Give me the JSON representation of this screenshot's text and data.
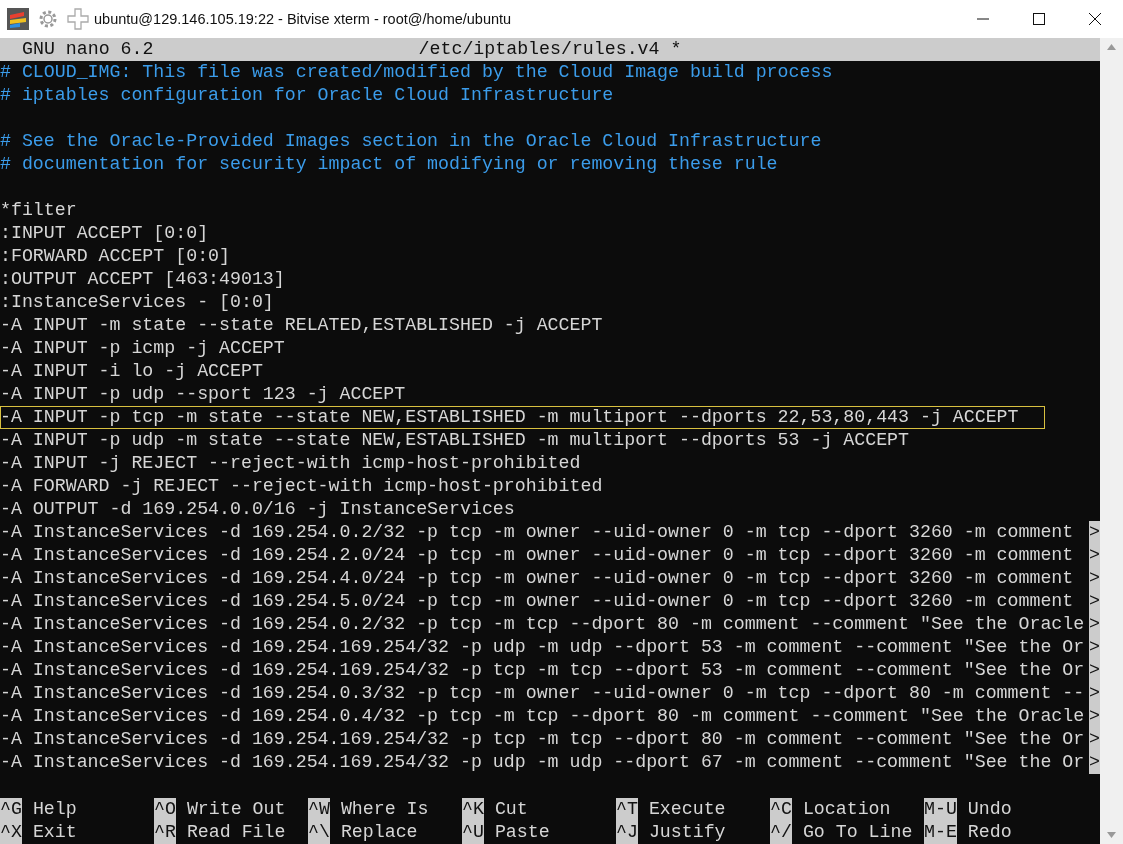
{
  "window": {
    "title": "ubuntu@129.146.105.19:22 - Bitvise xterm - root@/home/ubuntu"
  },
  "nano_header": {
    "app": "GNU nano 6.2",
    "file": "/etc/iptables/rules.v4 *"
  },
  "lines": [
    {
      "kind": "comment",
      "text": "# CLOUD_IMG: This file was created/modified by the Cloud Image build process"
    },
    {
      "kind": "comment",
      "text": "# iptables configuration for Oracle Cloud Infrastructure"
    },
    {
      "kind": "blank"
    },
    {
      "kind": "comment",
      "text": "# See the Oracle-Provided Images section in the Oracle Cloud Infrastructure"
    },
    {
      "kind": "comment",
      "text": "# documentation for security impact of modifying or removing these rule"
    },
    {
      "kind": "blank"
    },
    {
      "kind": "code",
      "text": "*filter"
    },
    {
      "kind": "code",
      "text": ":INPUT ACCEPT [0:0]"
    },
    {
      "kind": "code",
      "text": ":FORWARD ACCEPT [0:0]"
    },
    {
      "kind": "code",
      "text": ":OUTPUT ACCEPT [463:49013]"
    },
    {
      "kind": "code",
      "text": ":InstanceServices - [0:0]"
    },
    {
      "kind": "code",
      "text": "-A INPUT -m state --state RELATED,ESTABLISHED -j ACCEPT"
    },
    {
      "kind": "code",
      "text": "-A INPUT -p icmp -j ACCEPT"
    },
    {
      "kind": "code",
      "text": "-A INPUT -i lo -j ACCEPT"
    },
    {
      "kind": "code",
      "text": "-A INPUT -p udp --sport 123 -j ACCEPT"
    },
    {
      "kind": "code",
      "text": "-A INPUT -p tcp -m state --state NEW,ESTABLISHED -m multiport --dports 22,53,80,443 -j ACCEPT",
      "highlighted": true
    },
    {
      "kind": "code",
      "text": "-A INPUT -p udp -m state --state NEW,ESTABLISHED -m multiport --dports 53 -j ACCEPT"
    },
    {
      "kind": "code",
      "text": "-A INPUT -j REJECT --reject-with icmp-host-prohibited"
    },
    {
      "kind": "code",
      "text": "-A FORWARD -j REJECT --reject-with icmp-host-prohibited"
    },
    {
      "kind": "code",
      "text": "-A OUTPUT -d 169.254.0.0/16 -j InstanceServices"
    },
    {
      "kind": "code",
      "text": "-A InstanceServices -d 169.254.0.2/32 -p tcp -m owner --uid-owner 0 -m tcp --dport 3260 -m comment",
      "more": ">"
    },
    {
      "kind": "code",
      "text": "-A InstanceServices -d 169.254.2.0/24 -p tcp -m owner --uid-owner 0 -m tcp --dport 3260 -m comment",
      "more": ">"
    },
    {
      "kind": "code",
      "text": "-A InstanceServices -d 169.254.4.0/24 -p tcp -m owner --uid-owner 0 -m tcp --dport 3260 -m comment",
      "more": ">"
    },
    {
      "kind": "code",
      "text": "-A InstanceServices -d 169.254.5.0/24 -p tcp -m owner --uid-owner 0 -m tcp --dport 3260 -m comment",
      "more": ">"
    },
    {
      "kind": "code",
      "text": "-A InstanceServices -d 169.254.0.2/32 -p tcp -m tcp --dport 80 -m comment --comment \"See the Oracle",
      "more": ">"
    },
    {
      "kind": "code",
      "text": "-A InstanceServices -d 169.254.169.254/32 -p udp -m udp --dport 53 -m comment --comment \"See the Or",
      "more": ">"
    },
    {
      "kind": "code",
      "text": "-A InstanceServices -d 169.254.169.254/32 -p tcp -m tcp --dport 53 -m comment --comment \"See the Or",
      "more": ">"
    },
    {
      "kind": "code",
      "text": "-A InstanceServices -d 169.254.0.3/32 -p tcp -m owner --uid-owner 0 -m tcp --dport 80 -m comment --",
      "more": ">"
    },
    {
      "kind": "code",
      "text": "-A InstanceServices -d 169.254.0.4/32 -p tcp -m tcp --dport 80 -m comment --comment \"See the Oracle",
      "more": ">"
    },
    {
      "kind": "code",
      "text": "-A InstanceServices -d 169.254.169.254/32 -p tcp -m tcp --dport 80 -m comment --comment \"See the Or",
      "more": ">"
    },
    {
      "kind": "code",
      "text": "-A InstanceServices -d 169.254.169.254/32 -p udp -m udp --dport 67 -m comment --comment \"See the Or",
      "more": ">"
    }
  ],
  "shortcuts": [
    {
      "key": "^G",
      "label": "Help"
    },
    {
      "key": "^O",
      "label": "Write Out"
    },
    {
      "key": "^W",
      "label": "Where Is"
    },
    {
      "key": "^K",
      "label": "Cut"
    },
    {
      "key": "^T",
      "label": "Execute"
    },
    {
      "key": "^C",
      "label": "Location"
    },
    {
      "key": "M-U",
      "label": "Undo"
    },
    {
      "key": "^X",
      "label": "Exit"
    },
    {
      "key": "^R",
      "label": "Read File"
    },
    {
      "key": "^\\",
      "label": "Replace"
    },
    {
      "key": "^U",
      "label": "Paste"
    },
    {
      "key": "^J",
      "label": "Justify"
    },
    {
      "key": "^/",
      "label": "Go To Line"
    },
    {
      "key": "M-E",
      "label": "Redo"
    }
  ]
}
